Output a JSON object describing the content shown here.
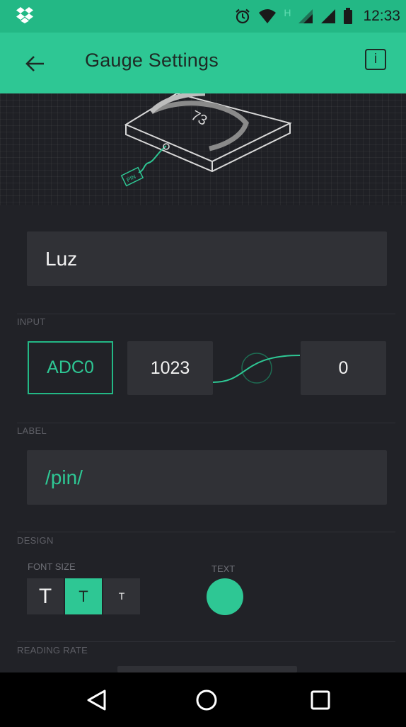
{
  "status_bar": {
    "time": "12:33",
    "icons": [
      "dropbox-icon",
      "alarm-icon",
      "wifi-icon",
      "signal-h-icon",
      "signal-icon",
      "signal-icon",
      "battery-icon"
    ]
  },
  "app_bar": {
    "title": "Gauge Settings",
    "back_icon": "arrow-left-icon",
    "info_label": "i"
  },
  "hero": {
    "gauge_value": "73",
    "pin_tag": "PIN"
  },
  "widget_name": "Luz",
  "input": {
    "section_label": "INPUT",
    "pin": "ADC0",
    "range_max": "1023",
    "range_min": "0"
  },
  "label": {
    "section_label": "LABEL",
    "value": "/pin/"
  },
  "design": {
    "section_label": "DESIGN",
    "font_size_label": "FONT SIZE",
    "font_sizes": [
      "T",
      "T",
      "T"
    ],
    "selected_font_size_index": 1,
    "text_color_label": "TEXT",
    "text_color": "#2ec794"
  },
  "reading_rate": {
    "section_label": "READING RATE"
  },
  "colors": {
    "accent": "#2ec794",
    "status_bar": "#23b885",
    "background": "#212227",
    "card": "#303136"
  },
  "nav_bar": {
    "buttons": [
      "back-triangle-icon",
      "home-circle-icon",
      "recents-square-icon"
    ]
  }
}
